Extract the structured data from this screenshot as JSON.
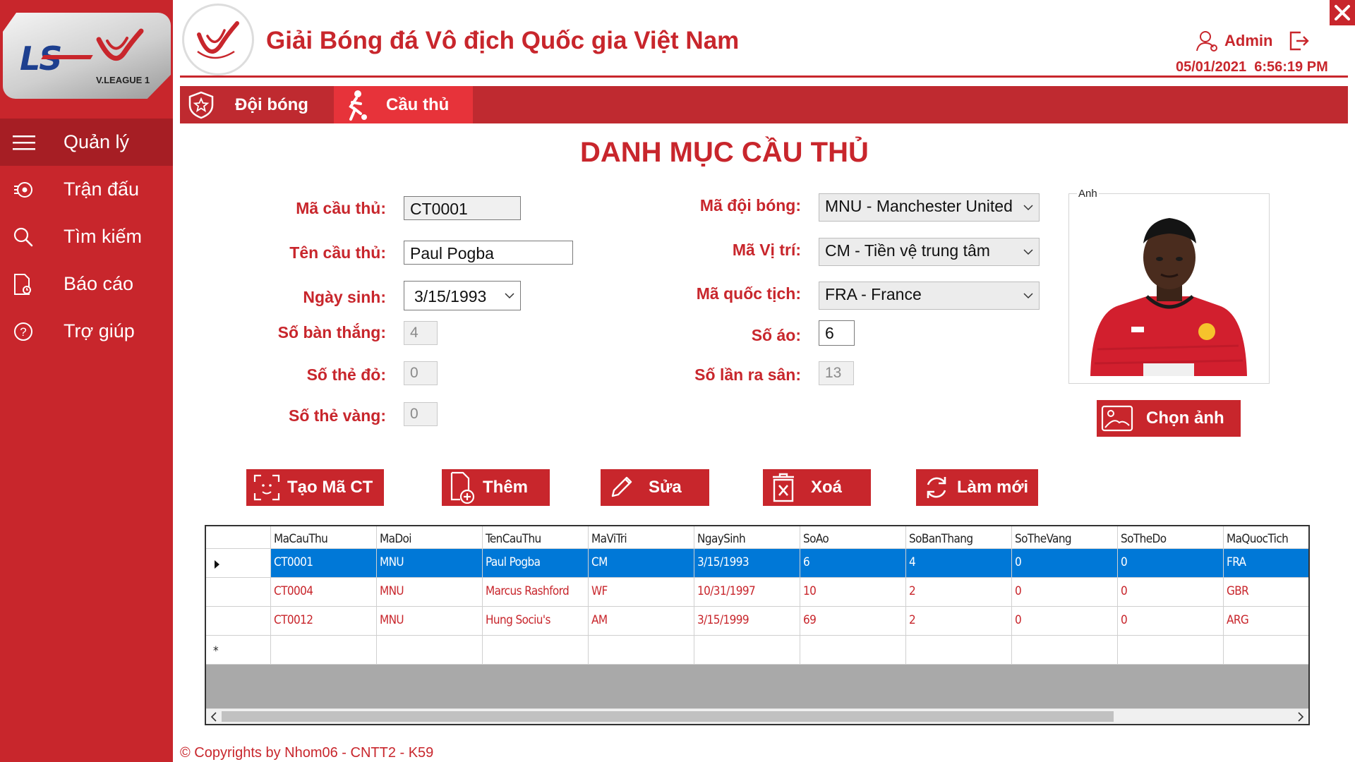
{
  "brand": {
    "logo_text": "LS",
    "logo_sub": "V.LEAGUE 1"
  },
  "sidebar": {
    "items": [
      {
        "label": "Quản lý",
        "icon": "menu-icon"
      },
      {
        "label": "Trận đấu",
        "icon": "match-icon"
      },
      {
        "label": "Tìm kiếm",
        "icon": "search-icon"
      },
      {
        "label": "Báo cáo",
        "icon": "report-icon"
      },
      {
        "label": "Trợ giúp",
        "icon": "help-icon"
      }
    ]
  },
  "header": {
    "title": "Giải Bóng đá Vô địch Quốc gia Việt Nam",
    "user": "Admin",
    "date": "05/01/2021",
    "time": "6:56:19 PM"
  },
  "tabs": [
    {
      "label": "Đội bóng",
      "icon": "shield-star-icon"
    },
    {
      "label": "Cầu thủ",
      "icon": "player-kick-icon"
    }
  ],
  "form": {
    "title": "DANH MỤC CẦU THỦ",
    "ma_cau_thu": {
      "label": "Mã cầu thủ:",
      "value": "CT0001"
    },
    "ten_cau_thu": {
      "label": "Tên cầu thủ:",
      "value": "Paul Pogba"
    },
    "ngay_sinh": {
      "label": "Ngày sinh:",
      "value": "3/15/1993"
    },
    "so_ban_thang": {
      "label": "Số bàn thắng:",
      "value": "4"
    },
    "so_the_do": {
      "label": "Số thẻ đỏ:",
      "value": "0"
    },
    "so_the_vang": {
      "label": "Số thẻ vàng:",
      "value": "0"
    },
    "ma_doi_bong": {
      "label": "Mã đội bóng:",
      "value": "MNU - Manchester United"
    },
    "ma_vi_tri": {
      "label": "Mã Vị trí:",
      "value": "CM - Tiền vệ trung tâm"
    },
    "ma_quoc_tich": {
      "label": "Mã quốc tịch:",
      "value": "FRA - France"
    },
    "so_ao": {
      "label": "Số áo:",
      "value": "6"
    },
    "so_lan_ra_san": {
      "label": "Số lần ra sân:",
      "value": "13"
    },
    "photo_caption": "Anh",
    "choose_photo": "Chọn ảnh"
  },
  "actions": {
    "tao_ma": "Tạo Mã CT",
    "them": "Thêm",
    "sua": "Sửa",
    "xoa": "Xoá",
    "lam_moi": "Làm mới"
  },
  "grid": {
    "columns": [
      "MaCauThu",
      "MaDoi",
      "TenCauThu",
      "MaViTri",
      "NgaySinh",
      "SoAo",
      "SoBanThang",
      "SoTheVang",
      "SoTheDo",
      "MaQuocTich"
    ],
    "rows": [
      [
        "CT0001",
        "MNU",
        "Paul Pogba",
        "CM",
        "3/15/1993",
        "6",
        "4",
        "0",
        "0",
        "FRA"
      ],
      [
        "CT0004",
        "MNU",
        "Marcus Rashford",
        "WF",
        "10/31/1997",
        "10",
        "2",
        "0",
        "0",
        "GBR"
      ],
      [
        "CT0012",
        "MNU",
        "Hung Sociu's",
        "AM",
        "3/15/1999",
        "69",
        "2",
        "0",
        "0",
        "ARG"
      ]
    ],
    "new_row_marker": "*"
  },
  "footer": "© Copyrights by Nhom06 - CNTT2 - K59",
  "colors": {
    "primary": "#c8262c",
    "selection": "#0078d7",
    "tab_active": "#e7333a"
  }
}
